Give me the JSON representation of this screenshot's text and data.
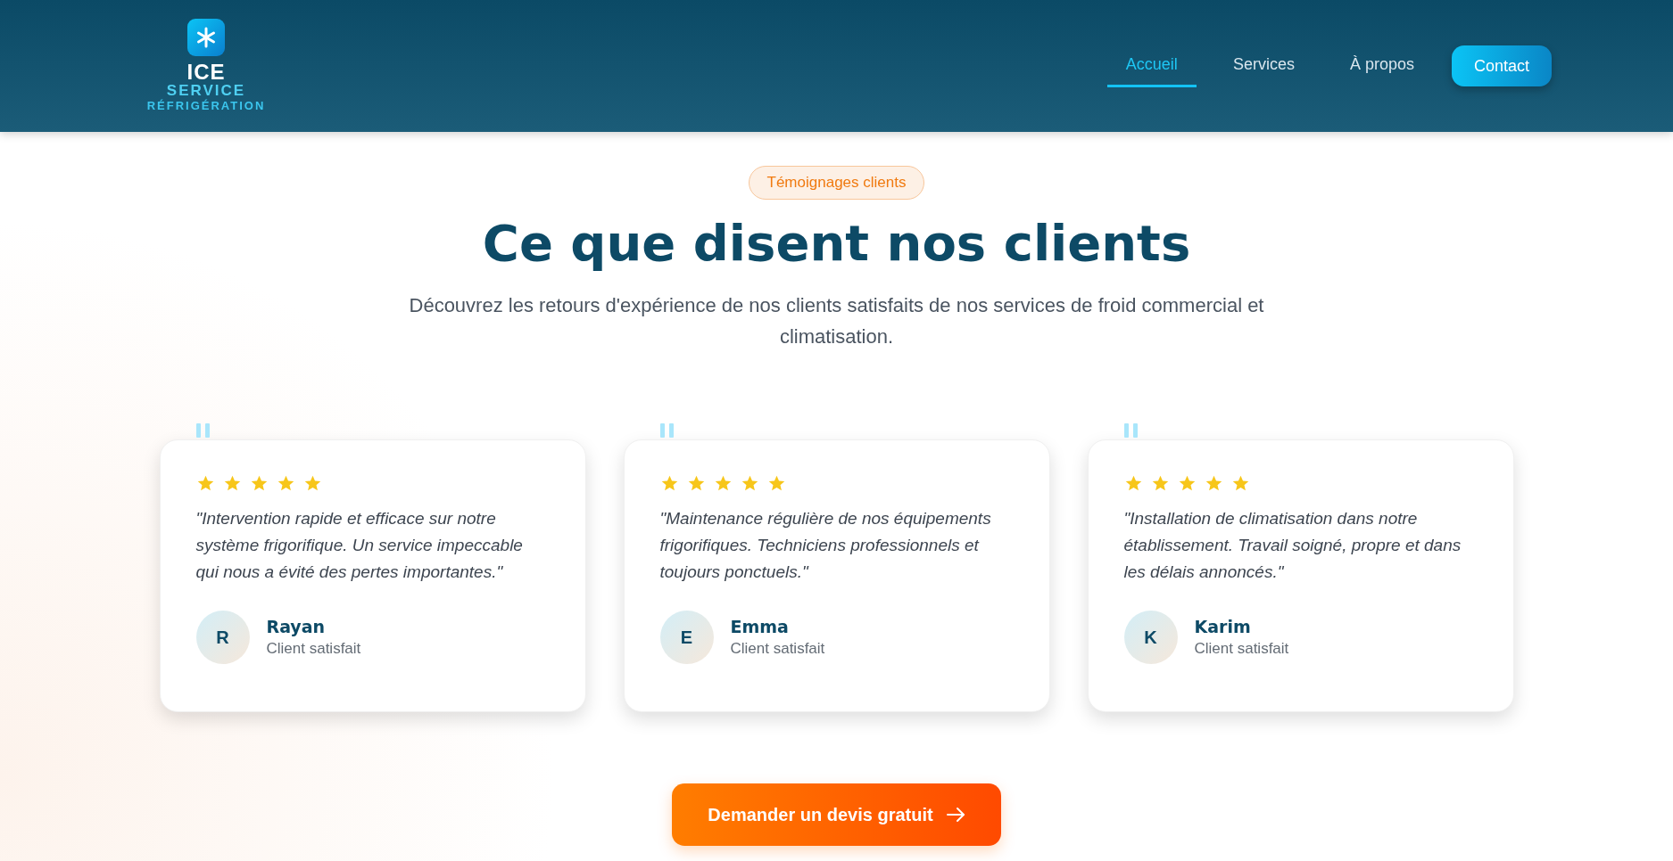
{
  "logo": {
    "line_1": "ICE",
    "line_2": "SERVICE",
    "line_3": "RÉFRIGÉRATION"
  },
  "nav": [
    {
      "label": "Accueil",
      "selected": true
    },
    {
      "label": "Services",
      "selected": false
    },
    {
      "label": "À propos",
      "selected": false
    }
  ],
  "contact_button": "Contact",
  "badge": "Témoignages clients",
  "heading": "Ce que disent nos clients",
  "subtitle": "Découvrez les retours d'expérience de nos clients satisfaits de nos services de froid commercial et climatisation.",
  "testimonials": [
    {
      "stars": 5,
      "quote": "\"Intervention rapide et efficace sur notre système frigorifique. Un service impeccable qui nous a évité des pertes importantes.\"",
      "initial": "R",
      "name": "Rayan",
      "role": "Client satisfait"
    },
    {
      "stars": 5,
      "quote": "\"Maintenance régulière de nos équipements frigorifiques. Techniciens professionnels et toujours ponctuels.\"",
      "initial": "E",
      "name": "Emma",
      "role": "Client satisfait"
    },
    {
      "stars": 5,
      "quote": "\"Installation de climatisation dans notre établissement. Travail soigné, propre et dans les délais annoncés.\"",
      "initial": "K",
      "name": "Karim",
      "role": "Client satisfait"
    }
  ],
  "cta_button": "Demander un devis gratuit"
}
